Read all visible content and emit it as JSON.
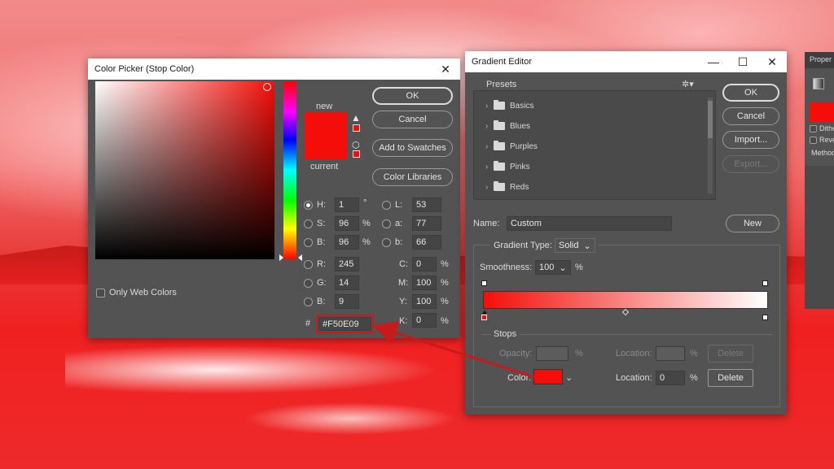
{
  "colors": {
    "stop_color": "#F50E09",
    "annotation_red": "#C91A1A",
    "dialog_bg": "#535353"
  },
  "color_picker": {
    "title": "Color Picker (Stop Color)",
    "close_icon": "close-icon",
    "new_label": "new",
    "current_label": "current",
    "buttons": {
      "ok": "OK",
      "cancel": "Cancel",
      "add_to_swatches": "Add to Swatches",
      "color_libraries": "Color Libraries"
    },
    "hsb": [
      {
        "label": "H:",
        "value": "1",
        "unit": "°",
        "selected": true
      },
      {
        "label": "S:",
        "value": "96",
        "unit": "%",
        "selected": false
      },
      {
        "label": "B:",
        "value": "96",
        "unit": "%",
        "selected": false
      }
    ],
    "rgb": [
      {
        "label": "R:",
        "value": "245"
      },
      {
        "label": "G:",
        "value": "14"
      },
      {
        "label": "B:",
        "value": "9"
      }
    ],
    "lab": [
      {
        "label": "L:",
        "value": "53"
      },
      {
        "label": "a:",
        "value": "77"
      },
      {
        "label": "b:",
        "value": "66"
      }
    ],
    "cmyk": [
      {
        "label": "C:",
        "value": "0",
        "unit": "%"
      },
      {
        "label": "M:",
        "value": "100",
        "unit": "%"
      },
      {
        "label": "Y:",
        "value": "100",
        "unit": "%"
      },
      {
        "label": "K:",
        "value": "0",
        "unit": "%"
      }
    ],
    "hex_label": "#",
    "hex_value": "#F50E09",
    "only_web_colors": "Only Web Colors"
  },
  "gradient_editor": {
    "title": "Gradient Editor",
    "presets_label": "Presets",
    "presets": [
      "Basics",
      "Blues",
      "Purples",
      "Pinks",
      "Reds"
    ],
    "buttons": {
      "ok": "OK",
      "cancel": "Cancel",
      "import": "Import...",
      "export": "Export...",
      "new": "New",
      "delete_disabled": "Delete",
      "delete": "Delete"
    },
    "name_label": "Name:",
    "name_value": "Custom",
    "gradient_type_label": "Gradient Type:",
    "gradient_type_value": "Solid",
    "smoothness_label": "Smoothness:",
    "smoothness_value": "100",
    "smoothness_unit": "%",
    "stops_label": "Stops",
    "opacity_label": "Opacity:",
    "opacity_unit": "%",
    "location_label": "Location:",
    "location_unit": "%",
    "color_label": "Color:",
    "color_location_value": "0"
  },
  "properties_panel": {
    "title": "Proper",
    "items": [
      "Dithe",
      "Reve",
      "Method"
    ]
  }
}
